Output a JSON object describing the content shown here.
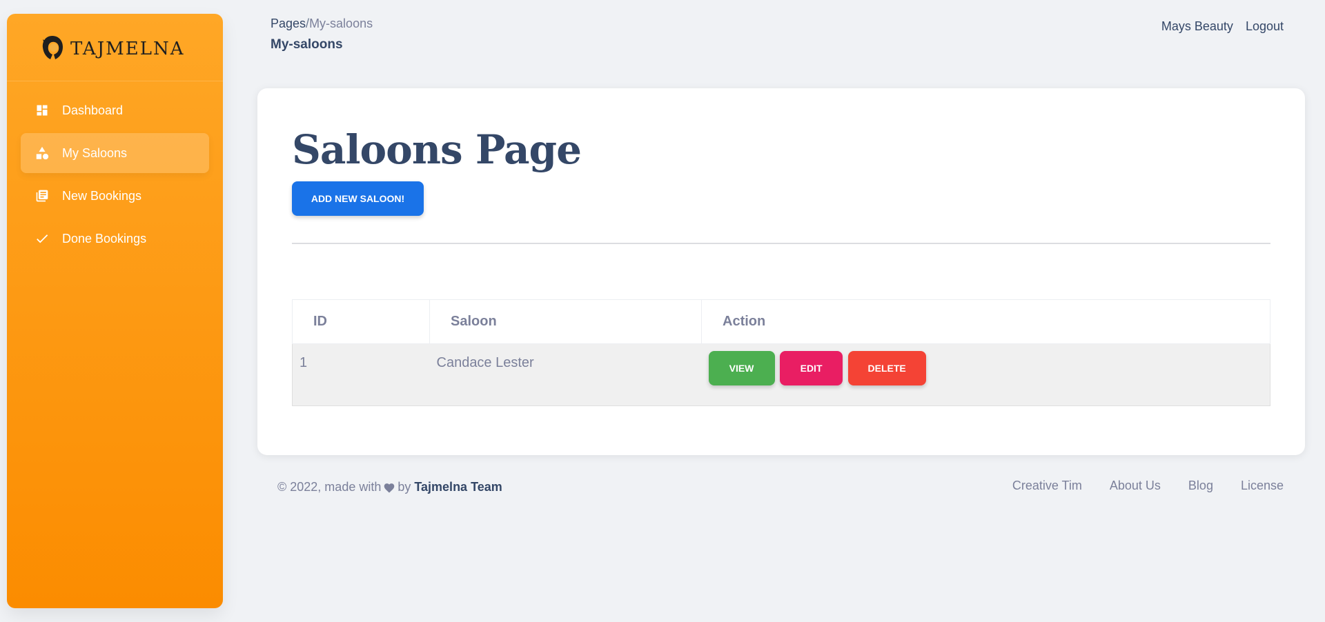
{
  "brand": {
    "name": "TAJMELNA"
  },
  "sidebar": {
    "items": [
      {
        "label": "Dashboard",
        "icon": "dashboard-icon",
        "active": false
      },
      {
        "label": "My Saloons",
        "icon": "shapes-icon",
        "active": true
      },
      {
        "label": "New Bookings",
        "icon": "library-books-icon",
        "active": false
      },
      {
        "label": "Done Bookings",
        "icon": "check-icon",
        "active": false
      }
    ]
  },
  "header": {
    "breadcrumb_root": "Pages",
    "breadcrumb_sep": "/",
    "breadcrumb_current": "My-saloons",
    "title": "My-saloons",
    "user": "Mays Beauty",
    "logout": "Logout"
  },
  "main": {
    "title": "Saloons Page",
    "add_button": "ADD NEW SALOON!",
    "table": {
      "columns": [
        "ID",
        "Saloon",
        "Action"
      ],
      "rows": [
        {
          "id": "1",
          "saloon": "Candace Lester"
        }
      ],
      "actions": {
        "view": "VIEW",
        "edit": "EDIT",
        "delete": "DELETE"
      }
    }
  },
  "footer": {
    "copyright": "© 2022, made with",
    "by": "by",
    "team": "Tajmelna Team",
    "links": [
      "Creative Tim",
      "About Us",
      "Blog",
      "License"
    ]
  },
  "colors": {
    "sidebar_gradient_top": "#ffa726",
    "sidebar_gradient_bottom": "#fb8c00",
    "primary": "#1a73e8",
    "success": "#4caf50",
    "pink": "#e91e63",
    "danger": "#f44335",
    "text_dark": "#344767",
    "text_muted": "#7b809a"
  }
}
